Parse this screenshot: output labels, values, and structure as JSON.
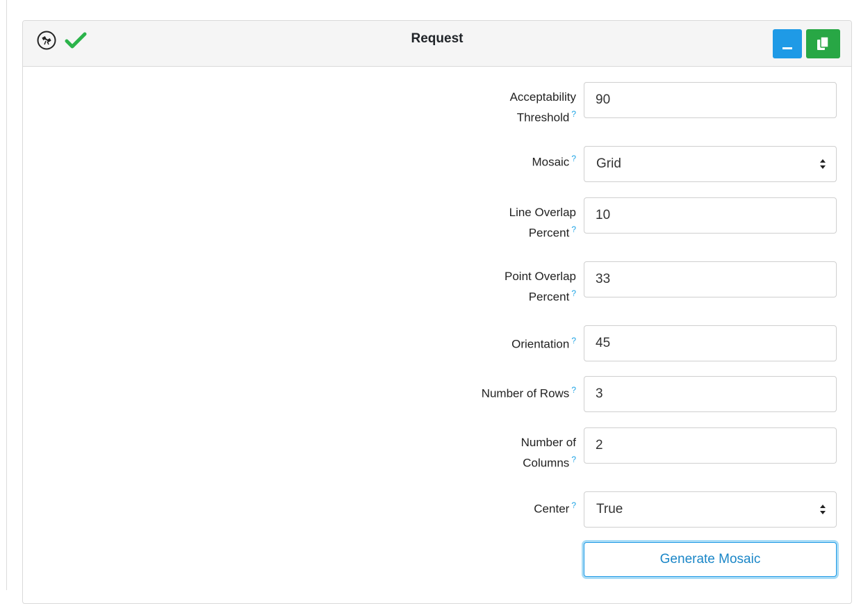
{
  "header": {
    "title": "Request",
    "satellite_icon": "satellite-icon",
    "status_icon": "checkmark-icon",
    "minimize_icon": "minimize-icon",
    "copy_icon": "copy-icon"
  },
  "colors": {
    "minimize_button": "#1f9ae6",
    "copy_button": "#28a745",
    "check": "#2bb34a",
    "help": "#1fa4e5",
    "primary_outline": "#1f9ae6"
  },
  "help_mark": "?",
  "fields": {
    "acceptability_threshold": {
      "label_line1": "Acceptability",
      "label_line2": "Threshold",
      "value": "90"
    },
    "mosaic": {
      "label": "Mosaic",
      "value": "Grid"
    },
    "line_overlap_percent": {
      "label_line1": "Line Overlap",
      "label_line2": "Percent",
      "value": "10"
    },
    "point_overlap_percent": {
      "label_line1": "Point Overlap",
      "label_line2": "Percent",
      "value": "33"
    },
    "orientation": {
      "label": "Orientation",
      "value": "45"
    },
    "number_of_rows": {
      "label": "Number of Rows",
      "value": "3"
    },
    "number_of_columns": {
      "label_line1": "Number of",
      "label_line2": "Columns",
      "value": "2"
    },
    "center": {
      "label": "Center",
      "value": "True"
    }
  },
  "generate_button_label": "Generate Mosaic"
}
